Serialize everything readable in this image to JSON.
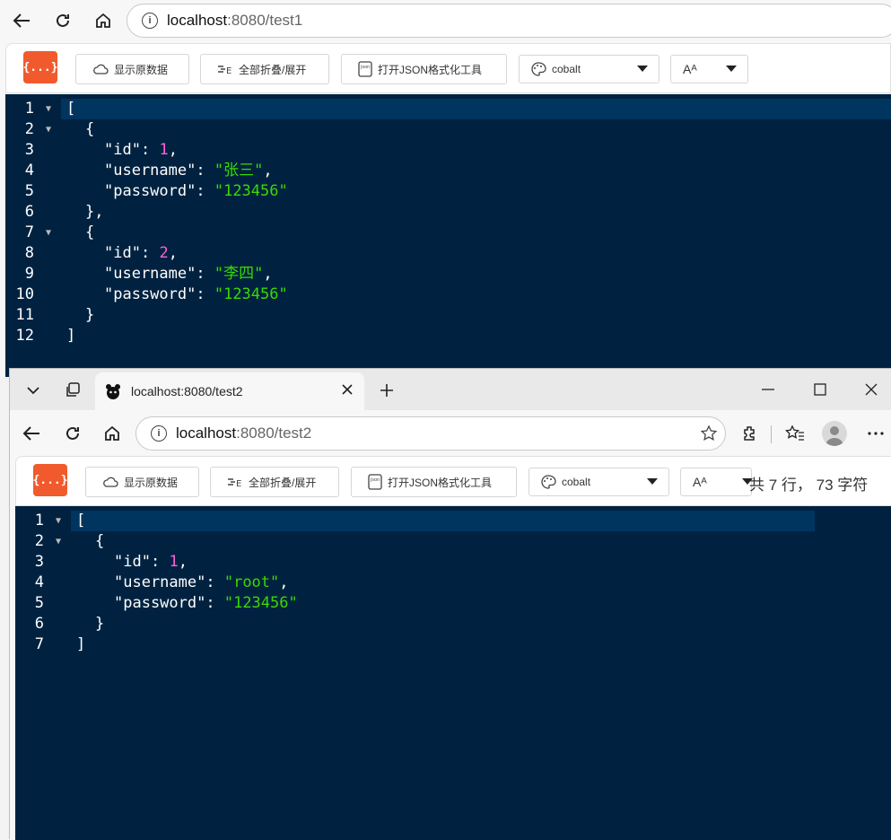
{
  "window1": {
    "url_host": "localhost",
    "url_rest": ":8080/test1",
    "toolbar": {
      "raw_label": "显示原数据",
      "fold_label": "全部折叠/展开",
      "open_label": "打开JSON格式化工具",
      "theme_value": "cobalt",
      "font_label": "Aᴬ"
    },
    "lines": [
      "1",
      "2",
      "3",
      "4",
      "5",
      "6",
      "7",
      "8",
      "9",
      "10",
      "11",
      "12"
    ]
  },
  "window2": {
    "tab_title": "localhost:8080/test2",
    "url_host": "localhost",
    "url_rest": ":8080/test2",
    "toolbar": {
      "raw_label": "显示原数据",
      "fold_label": "全部折叠/展开",
      "open_label": "打开JSON格式化工具",
      "theme_value": "cobalt",
      "font_label": "Aᴬ",
      "stats": "共 7 行， 73 字符"
    },
    "lines": [
      "1",
      "2",
      "3",
      "4",
      "5",
      "6",
      "7"
    ]
  },
  "json1": [
    {
      "id": "1",
      "username": "\"张三\"",
      "password": "\"123456\""
    },
    {
      "id": "2",
      "username": "\"李四\"",
      "password": "\"123456\""
    }
  ],
  "json2": [
    {
      "id": "1",
      "username": "\"root\"",
      "password": "\"123456\""
    }
  ],
  "colors": {
    "editor_bg": "#002240",
    "number": "#ff62d6",
    "string": "#3ad900",
    "logo": "#f15a2c"
  }
}
